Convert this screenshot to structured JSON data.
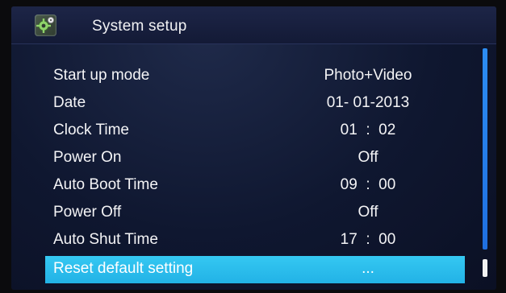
{
  "header": {
    "title": "System setup",
    "icon": "gear-settings-icon"
  },
  "menu": {
    "items": [
      {
        "label": "Start up mode",
        "value": "Photo+Video",
        "selected": false
      },
      {
        "label": "Date",
        "value": "01- 01-2013",
        "selected": false
      },
      {
        "label": "Clock Time",
        "value": "01  :  02",
        "selected": false
      },
      {
        "label": "Power On",
        "value": "Off",
        "selected": false
      },
      {
        "label": "Auto Boot Time",
        "value": "09  :  00",
        "selected": false
      },
      {
        "label": "Power Off",
        "value": "Off",
        "selected": false
      },
      {
        "label": "Auto Shut Time",
        "value": "17  :  00",
        "selected": false
      },
      {
        "label": "Reset default setting",
        "value": "...",
        "selected": true
      }
    ]
  },
  "colors": {
    "background": "#0f1730",
    "selection": "#2ab9ec",
    "scrollbar": "#1f6fe0",
    "text": "#f4f4f6"
  }
}
